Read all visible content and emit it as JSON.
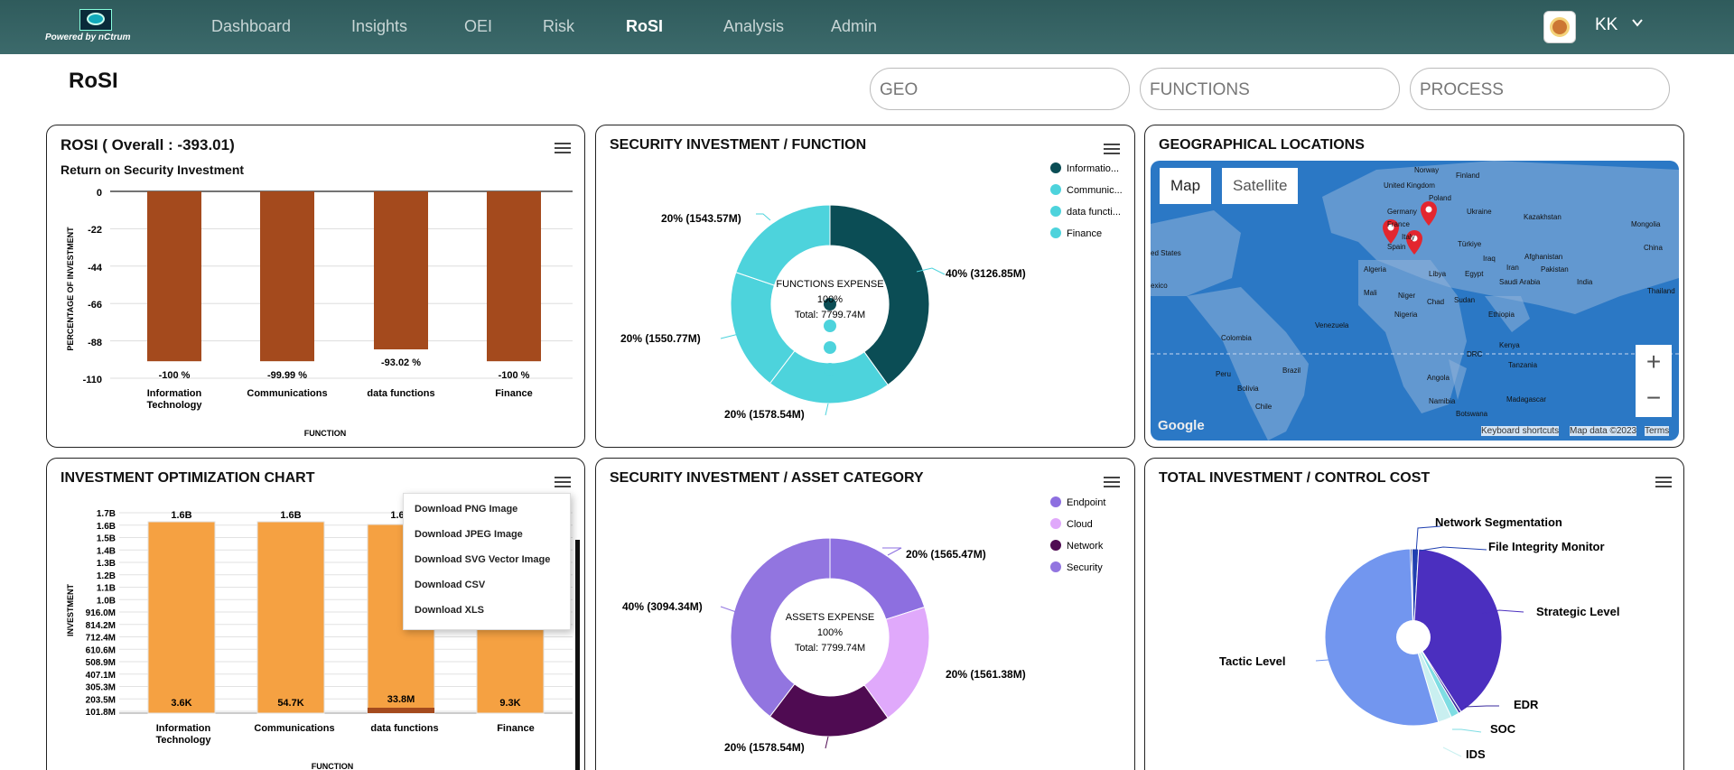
{
  "header": {
    "powered_by": "Powered by nCtrum",
    "nav": [
      "Dashboard",
      "Insights",
      "OEI",
      "Risk",
      "RoSI",
      "Analysis",
      "Admin"
    ],
    "active_nav": "RoSI",
    "user_initials": "KK",
    "icons": [
      "logo-eye-icon",
      "avatar-icon",
      "chevron-down-icon"
    ]
  },
  "page": {
    "title": "RoSI",
    "filters": [
      "GEO",
      "FUNCTIONS",
      "PROCESS"
    ]
  },
  "rosi_card": {
    "title": "ROSI ( Overall : -393.01)",
    "subtitle": "Return on Security Investment",
    "chart_data": {
      "type": "bar",
      "title": "Return on Security Investment",
      "categories": [
        "Information Technology",
        "Communications",
        "data functions",
        "Finance"
      ],
      "values": [
        -100,
        -99.99,
        -93.02,
        -100
      ],
      "data_labels": [
        "-100 %",
        "-99.99 %",
        "-93.02 %",
        "-100 %"
      ],
      "xlabel": "FUNCTION",
      "ylabel": "PERCENTAGE OF INVESTMENT",
      "yticks": [
        "0",
        "-22",
        "-44",
        "-66",
        "-88",
        "-110"
      ],
      "ylim": [
        -110,
        0
      ],
      "color": "#a44a1d"
    }
  },
  "sec_function_card": {
    "title": "SECURITY INVESTMENT / FUNCTION",
    "center": [
      "FUNCTIONS EXPENSE",
      "100%",
      "Total: 7799.74M"
    ],
    "chart_data": {
      "type": "pie",
      "labels": [
        "Information Technology",
        "Communications",
        "data functions",
        "Finance"
      ],
      "legend": [
        "Informatio...",
        "Communic...",
        "data functi...",
        "Finance"
      ],
      "values": [
        3126.85,
        1578.54,
        1550.77,
        1543.57
      ],
      "data_labels": [
        "40% (3126.85M)",
        "20% (1578.54M)",
        "20% (1550.77M)",
        "20% (1543.57M)"
      ],
      "colors": [
        "#0b4d55",
        "#4dd3dc",
        "#4dd3dc",
        "#4dd3dc"
      ]
    }
  },
  "geo_card": {
    "title": "GEOGRAPHICAL LOCATIONS",
    "map_buttons": [
      "Map",
      "Satellite"
    ],
    "zoom_in": "+",
    "zoom_out": "−",
    "attribution": "Google",
    "footer": [
      "Keyboard shortcuts",
      "Map data ©2023",
      "Terms"
    ],
    "labels": [
      "Norway",
      "Finland",
      "United Kingdom",
      "Poland",
      "Germany",
      "Ukraine",
      "France",
      "Kazakhstan",
      "Italy",
      "Mongolia",
      "Spain",
      "Türkiye",
      "Iraq",
      "Afghanistan",
      "China",
      "ed States",
      "Iran",
      "Pakistan",
      "Algeria",
      "Libya",
      "Egypt",
      "Saudi Arabia",
      "India",
      "Thailand",
      "exico",
      "Mali",
      "Niger",
      "Chad",
      "Sudan",
      "Nigeria",
      "Ethiopia",
      "Venezuela",
      "Colombia",
      "Kenya",
      "DRC",
      "Tanzania",
      "Peru",
      "Brazil",
      "Angola",
      "Bolivia",
      "Namibia",
      "Madagascar",
      "Botswana",
      "Chile"
    ],
    "icons": [
      "map-pin-icon",
      "map-pin-icon",
      "map-pin-icon"
    ]
  },
  "io_card": {
    "title": "INVESTMENT OPTIMIZATION CHART",
    "menu": [
      "Download PNG Image",
      "Download JPEG Image",
      "Download SVG Vector Image",
      "Download CSV",
      "Download XLS"
    ],
    "chart_data": {
      "type": "bar",
      "categories": [
        "Information Technology",
        "Communications",
        "data functions",
        "Finance"
      ],
      "series": [
        {
          "values": [
            1.6,
            1.6,
            1.6,
            1.6
          ],
          "data_labels": [
            "1.6B",
            "1.6B",
            "1.6",
            ""
          ]
        },
        {
          "values": [
            3.6e-06,
            5.47e-05,
            0.0338,
            9.3e-06
          ],
          "data_labels": [
            "3.6K",
            "54.7K",
            "33.8M",
            "9.3K"
          ]
        }
      ],
      "xlabel": "FUNCTION",
      "ylabel": "INVESTMENT",
      "yticks": [
        "1.7B",
        "1.6B",
        "1.5B",
        "1.4B",
        "1.3B",
        "1.2B",
        "1.1B",
        "1.0B",
        "916.0M",
        "814.2M",
        "712.4M",
        "610.6M",
        "508.9M",
        "407.1M",
        "305.3M",
        "203.5M",
        "101.8M"
      ],
      "color": "#f5a142"
    }
  },
  "asset_card": {
    "title": "SECURITY INVESTMENT / ASSET CATEGORY",
    "center": [
      "ASSETS EXPENSE",
      "100%",
      "Total: 7799.74M"
    ],
    "chart_data": {
      "type": "pie",
      "labels": [
        "Endpoint",
        "Cloud",
        "Network",
        "Security"
      ],
      "values": [
        1565.47,
        1561.38,
        1578.54,
        3094.34
      ],
      "data_labels": [
        "20% (1565.47M)",
        "20% (1561.38M)",
        "20% (1578.54M)",
        "40% (3094.34M)"
      ],
      "colors": [
        "#8d6fe0",
        "#e0a9fb",
        "#4f0b52",
        "#9275e0"
      ]
    }
  },
  "control_card": {
    "title": "TOTAL INVESTMENT / CONTROL COST",
    "chart_data": {
      "type": "pie",
      "labels": [
        "Network Segmentation",
        "File Integrity Monitor",
        "Strategic Level",
        "EDR",
        "SOC",
        "IDS",
        "Tactic Level"
      ],
      "values": [
        0.3,
        1.2,
        40,
        0.5,
        1.5,
        2.5,
        54
      ],
      "colors": [
        "#0a1a66",
        "#1f3fb0",
        "#4b2fbf",
        "#3a2a9e",
        "#7fdde3",
        "#c9eff0",
        "#7296ef"
      ]
    }
  }
}
